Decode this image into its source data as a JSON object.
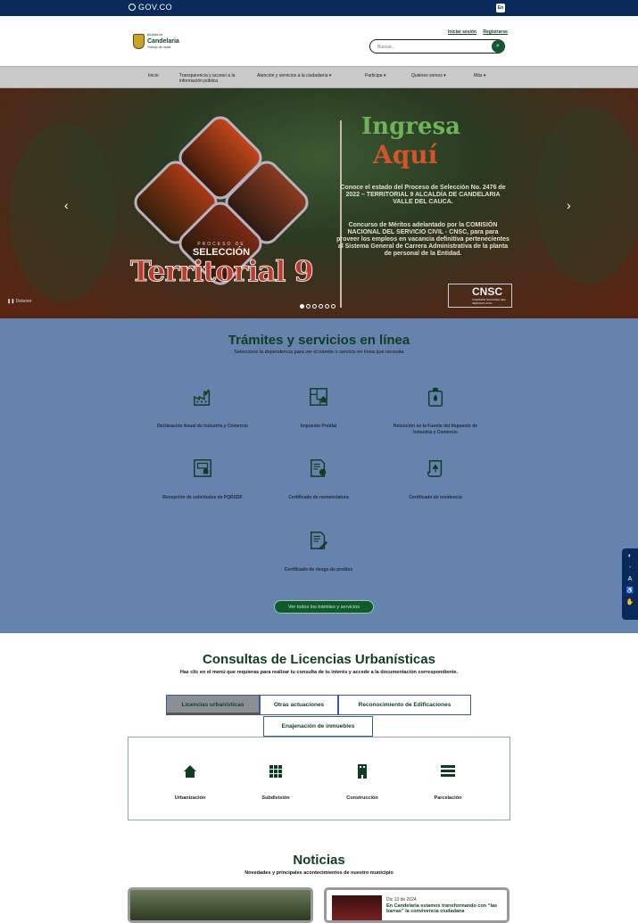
{
  "gov": {
    "logo": "GOV.CO",
    "lang": "En"
  },
  "header": {
    "logo_small": "Alcaldía de",
    "logo_name": "Candelaria",
    "logo_tag": "Trabajo de rodas",
    "login": "Iniciar sesión",
    "register": "Registrarse",
    "search_placeholder": "Buscar..."
  },
  "nav": {
    "items": [
      "Inicio",
      "Transparencia y acceso a la información pública",
      "Atención y servicios a la ciudadanía ▾",
      "Participa ▾",
      "Quiénes somos ▾",
      "Más ▾"
    ]
  },
  "hero": {
    "proceso": "PROCESO DE",
    "seleccion": "SELECCIÓN",
    "territorial": "Territorial 9",
    "ingresa": "Ingresa",
    "aqui": "Aquí",
    "p1": "Conoce el estado del Proceso de Selección No. 2476 de 2022 – TERRITORIAL 9 ALCALDÍA DE CANDELARIA VALLE DEL CAUCA.",
    "p2": "Concurso de Méritos adelantado por la COMISIÓN NACIONAL DEL SERVICIO CIVIL - CNSC, para para proveer los empleos en vacancia definitiva pertenecientes al Sistema General de Carrera Administrativa de la planta de personal de la Entidad.",
    "cnsc": "CNSC",
    "cnsc_small": "COMISIÓN NACIONAL DEL SERVICIO CIVIL",
    "pause_label": "Detener",
    "prev": "‹",
    "next": "›",
    "slides": 6,
    "active_slide": 1
  },
  "tramites": {
    "title": "Trámites y servicios en línea",
    "subtitle": "Seleccione la dependencia para ver el trámite o servicio en línea que necesita",
    "items": [
      {
        "label": "Declaración Anual de Industria y Comercio",
        "icon": "factory-icon"
      },
      {
        "label": "Impuesto Predial",
        "icon": "property-map-icon"
      },
      {
        "label": "Retención en la Fuente del Impuesto de Industria y Comercio",
        "icon": "bottle-fire-icon"
      },
      {
        "label": "Recepción de solicitudes de PQRSDF",
        "icon": "inbox-map-icon"
      },
      {
        "label": "Certificado de nomenclatura",
        "icon": "certificate-icon"
      },
      {
        "label": "Certificado de residencia",
        "icon": "scroll-tree-icon"
      },
      {
        "label": "Certificado de riesgo de predios",
        "icon": "document-pen-icon"
      }
    ],
    "button": "Ver todos los trámites y servicios"
  },
  "licencias": {
    "title": "Consultas de Licencias Urbanísticas",
    "subtitle": "Haz clic en el menú que requieras para realizar tu consulta de tu interés y accede a la documentación correspondiente.",
    "tabs": [
      "Licencias urbanísticas",
      "Otras actuaciones",
      "Reconocimiento de Edificaciones",
      "Enajenación de inmuebles"
    ],
    "items": [
      {
        "label": "Urbanización",
        "icon": "home-icon"
      },
      {
        "label": "Subdivisión",
        "icon": "grid-icon"
      },
      {
        "label": "Construcción",
        "icon": "building-icon"
      },
      {
        "label": "Parcelación",
        "icon": "list-bars-icon"
      }
    ]
  },
  "noticias": {
    "title": "Noticias",
    "subtitle": "Novedades y principales acontecimientos de nuestro municipio",
    "card2_date": "Dic 13 de 2024",
    "card2_head": "En Candelaria estamos transformando con “las barras” la convivencia ciudadana"
  },
  "colors": {
    "gov_blue": "#0a2a5c",
    "green": "#0f3d22",
    "tramites_bg": "#6683ae"
  }
}
